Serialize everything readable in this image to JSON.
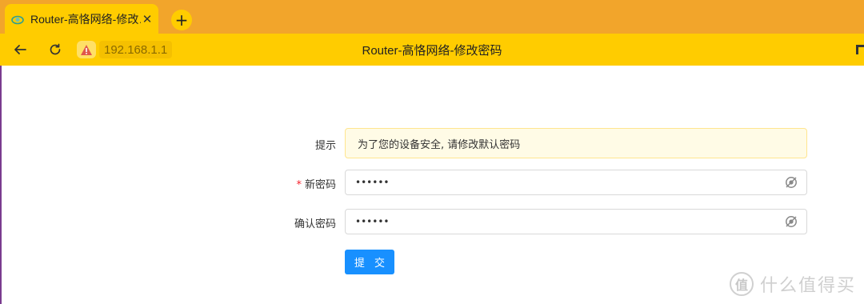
{
  "browser": {
    "tab": {
      "title": "Router-高恪网络-修改…",
      "close_glyph": "✕"
    },
    "new_tab_glyph": "+",
    "toolbar": {
      "url": "192.168.1.1",
      "page_title": "Router-高恪网络-修改密码"
    },
    "colors": {
      "tabbar": "#f2a52b",
      "toolbar": "#ffcc00"
    }
  },
  "form": {
    "hint": {
      "label": "提示",
      "text": "为了您的设备安全, 请修改默认密码"
    },
    "new_password": {
      "required_mark": "*",
      "label": "新密码",
      "value": "••••••"
    },
    "confirm_password": {
      "label": "确认密码",
      "value": "••••••"
    },
    "submit_label": "提 交",
    "colors": {
      "primary": "#1890ff",
      "alert_bg": "#fffbe6",
      "alert_border": "#ffe58f",
      "required": "#f5222d"
    }
  },
  "watermark": {
    "badge": "值",
    "text": "什么值得买"
  }
}
